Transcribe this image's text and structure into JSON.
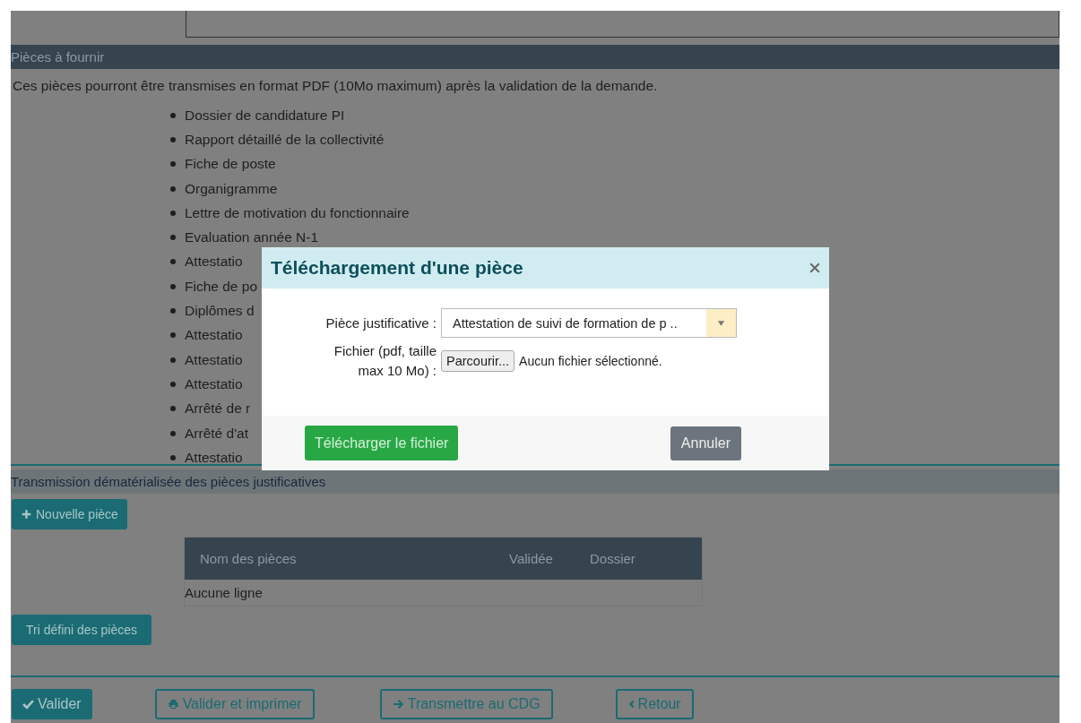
{
  "section_pieces": {
    "title": "Pièces à fournir",
    "intro": "Ces pièces pourront être transmises en format PDF (10Mo maximum) après la validation de la demande.",
    "items": [
      "Dossier de candidature PI",
      "Rapport détaillé de la collectivité",
      "Fiche de poste",
      "Organigramme",
      "Lettre de motivation du fonctionnaire",
      "Evaluation année N-1",
      "Attestatio",
      "Fiche de po",
      "Diplômes d",
      "Attestatio",
      "Attestatio",
      "Attestatio",
      "Arrêté de r",
      "Arrêté d'at",
      "Attestatio"
    ]
  },
  "section_transmission": {
    "title": "Transmission dématérialisée des pièces justificatives",
    "new_button": "Nouvelle pièce",
    "table": {
      "columns": [
        "Nom des pièces",
        "Validée",
        "Dossier"
      ],
      "empty": "Aucune ligne"
    },
    "sort_button": "Tri défini des pièces"
  },
  "actions": [
    {
      "label": "Valider",
      "kind": "confirm"
    },
    {
      "label": "Valider et imprimer",
      "kind": "print"
    },
    {
      "label": "Transmettre au CDG",
      "kind": "transmit"
    },
    {
      "label": "Retour",
      "kind": "back"
    }
  ],
  "modal": {
    "title": "Téléchargement d'une pièce",
    "piece_label": "Pièce justificative :",
    "piece_value": "Attestation de suivi de formation de p ..",
    "file_label": "Fichier (pdf, taille max 10 Mo) :",
    "browse_button": "Parcourir...",
    "file_status": "Aucun fichier sélectionné.",
    "upload_button": "Télécharger le fichier",
    "cancel_button": "Annuler"
  }
}
